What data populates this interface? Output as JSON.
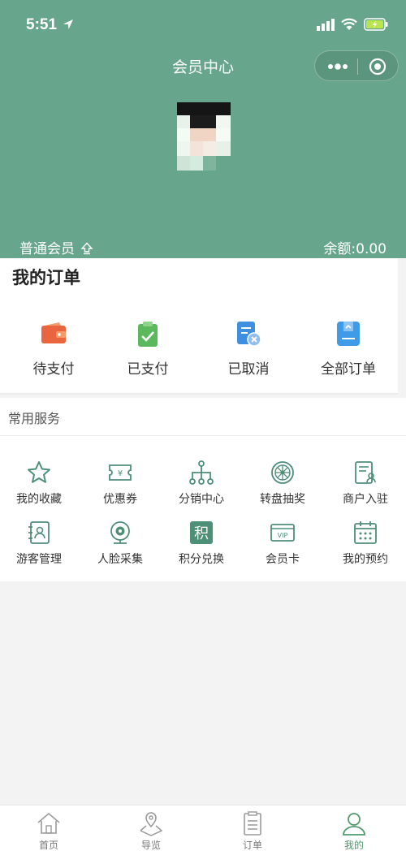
{
  "status_bar": {
    "time": "5:51"
  },
  "header": {
    "title": "会员中心",
    "member_level": "普通会员",
    "balance": "余额:0.00",
    "bg_color": "#67a68c"
  },
  "orders": {
    "title": "我的订单",
    "items": [
      {
        "label": "待支付",
        "icon": "wallet-icon",
        "color": "#e8653f"
      },
      {
        "label": "已支付",
        "icon": "paid-clipboard-icon",
        "color": "#5cb85c"
      },
      {
        "label": "已取消",
        "icon": "cancelled-doc-icon",
        "color": "#3f8fe0"
      },
      {
        "label": "全部订单",
        "icon": "all-orders-icon",
        "color": "#3f9be8"
      }
    ]
  },
  "services": {
    "title": "常用服务",
    "items": [
      {
        "label": "我的收藏",
        "icon": "star-icon"
      },
      {
        "label": "优惠券",
        "icon": "coupon-icon"
      },
      {
        "label": "分销中心",
        "icon": "network-icon"
      },
      {
        "label": "转盘抽奖",
        "icon": "lottery-wheel-icon"
      },
      {
        "label": "商户入驻",
        "icon": "merchant-doc-icon"
      },
      {
        "label": "游客管理",
        "icon": "visitor-book-icon"
      },
      {
        "label": "人脸采集",
        "icon": "camera-icon"
      },
      {
        "label": "积分兑换",
        "icon": "points-icon",
        "glyph": "积"
      },
      {
        "label": "会员卡",
        "icon": "vip-card-icon",
        "glyph": "VIP"
      },
      {
        "label": "我的预约",
        "icon": "calendar-icon"
      }
    ],
    "accent_color": "#4e8f78"
  },
  "tabbar": {
    "items": [
      {
        "label": "首页",
        "icon": "home-icon"
      },
      {
        "label": "导览",
        "icon": "map-pin-icon"
      },
      {
        "label": "订单",
        "icon": "order-list-icon"
      },
      {
        "label": "我的",
        "icon": "user-icon",
        "active": true
      }
    ],
    "active_color": "#4e9a6e"
  }
}
